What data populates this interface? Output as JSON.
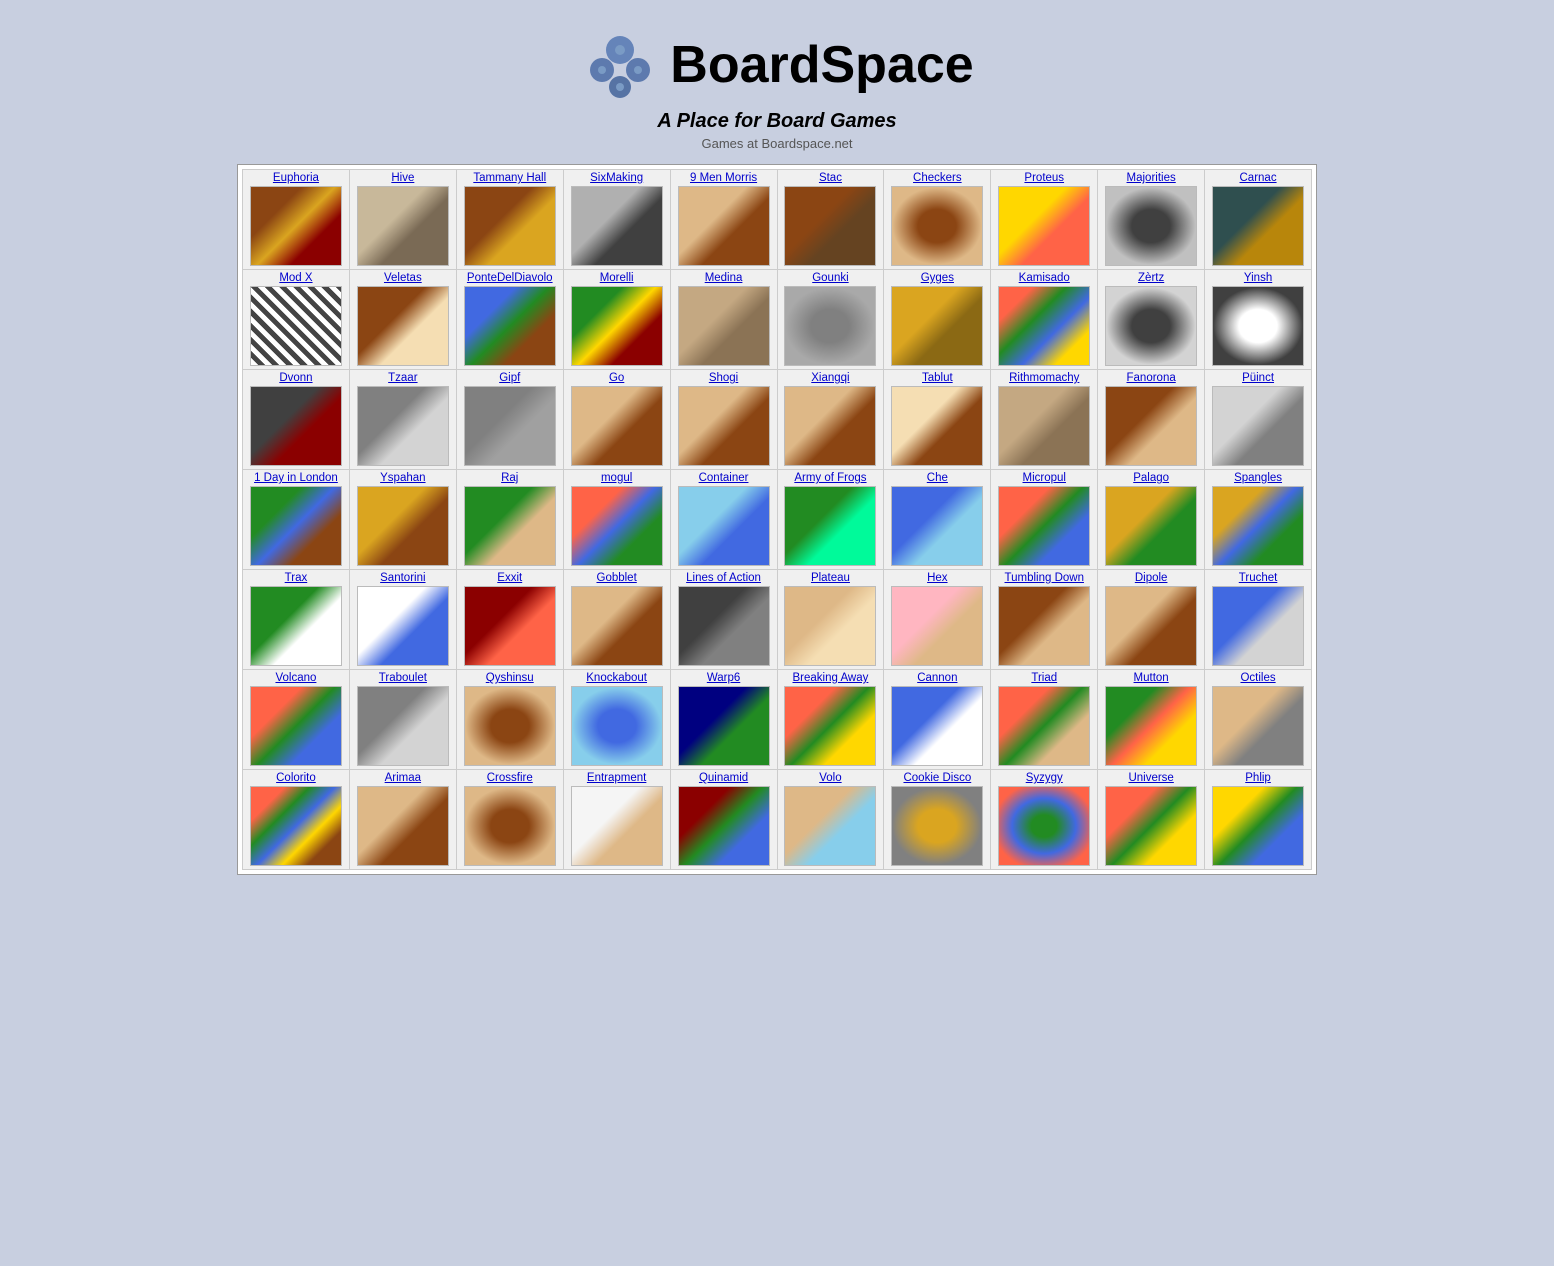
{
  "site": {
    "title": "BoardSpace",
    "tagline": "A Place for Board Games",
    "games_label": "Games at Boardspace.net"
  },
  "rows": [
    [
      {
        "name": "Euphoria",
        "thumb_class": "thumb-euphoria"
      },
      {
        "name": "Hive",
        "thumb_class": "thumb-hive"
      },
      {
        "name": "Tammany Hall",
        "thumb_class": "thumb-tammany"
      },
      {
        "name": "SixMaking",
        "thumb_class": "thumb-sixmaking"
      },
      {
        "name": "9 Men Morris",
        "thumb_class": "thumb-9men"
      },
      {
        "name": "Stac",
        "thumb_class": "thumb-stac"
      },
      {
        "name": "Checkers",
        "thumb_class": "thumb-checkers"
      },
      {
        "name": "Proteus",
        "thumb_class": "thumb-proteus"
      },
      {
        "name": "Majorities",
        "thumb_class": "thumb-majorities"
      },
      {
        "name": "Carnac",
        "thumb_class": "thumb-carnac"
      }
    ],
    [
      {
        "name": "Mod X",
        "thumb_class": "thumb-modx"
      },
      {
        "name": "Veletas",
        "thumb_class": "thumb-veletas"
      },
      {
        "name": "PonteDelDiavolo",
        "thumb_class": "thumb-ponte"
      },
      {
        "name": "Morelli",
        "thumb_class": "thumb-morelli"
      },
      {
        "name": "Medina",
        "thumb_class": "thumb-medina"
      },
      {
        "name": "Gounki",
        "thumb_class": "thumb-gounki"
      },
      {
        "name": "Gyges",
        "thumb_class": "thumb-gyges"
      },
      {
        "name": "Kamisado",
        "thumb_class": "thumb-kamisado"
      },
      {
        "name": "Zèrtz",
        "thumb_class": "thumb-zertz"
      },
      {
        "name": "Yinsh",
        "thumb_class": "thumb-yinsh"
      }
    ],
    [
      {
        "name": "Dvonn",
        "thumb_class": "thumb-dvonn"
      },
      {
        "name": "Tzaar",
        "thumb_class": "thumb-tzaar"
      },
      {
        "name": "Gipf",
        "thumb_class": "thumb-gipf"
      },
      {
        "name": "Go",
        "thumb_class": "thumb-go"
      },
      {
        "name": "Shogi",
        "thumb_class": "thumb-shogi"
      },
      {
        "name": "Xiangqi",
        "thumb_class": "thumb-xiangqi"
      },
      {
        "name": "Tablut",
        "thumb_class": "thumb-tablut"
      },
      {
        "name": "Rithmomachy",
        "thumb_class": "thumb-rithmom"
      },
      {
        "name": "Fanorona",
        "thumb_class": "thumb-fanorona"
      },
      {
        "name": "Püinct",
        "thumb_class": "thumb-punct"
      }
    ],
    [
      {
        "name": "1 Day in London",
        "thumb_class": "thumb-1day"
      },
      {
        "name": "Yspahan",
        "thumb_class": "thumb-yspahan"
      },
      {
        "name": "Raj",
        "thumb_class": "thumb-raj"
      },
      {
        "name": "mogul",
        "thumb_class": "thumb-mogul"
      },
      {
        "name": "Container",
        "thumb_class": "thumb-container"
      },
      {
        "name": "Army of Frogs",
        "thumb_class": "thumb-armyfrogs"
      },
      {
        "name": "Che",
        "thumb_class": "thumb-che"
      },
      {
        "name": "Micropul",
        "thumb_class": "thumb-micropul"
      },
      {
        "name": "Palago",
        "thumb_class": "thumb-palago"
      },
      {
        "name": "Spangles",
        "thumb_class": "thumb-spangles"
      }
    ],
    [
      {
        "name": "Trax",
        "thumb_class": "thumb-trax"
      },
      {
        "name": "Santorini",
        "thumb_class": "thumb-santorini"
      },
      {
        "name": "Exxit",
        "thumb_class": "thumb-exxit"
      },
      {
        "name": "Gobblet",
        "thumb_class": "thumb-gobblet"
      },
      {
        "name": "Lines of Action",
        "thumb_class": "thumb-loa"
      },
      {
        "name": "Plateau",
        "thumb_class": "thumb-plateau"
      },
      {
        "name": "Hex",
        "thumb_class": "thumb-hex"
      },
      {
        "name": "Tumbling Down",
        "thumb_class": "thumb-tumbling"
      },
      {
        "name": "Dipole",
        "thumb_class": "thumb-dipole"
      },
      {
        "name": "Truchet",
        "thumb_class": "thumb-truchet"
      }
    ],
    [
      {
        "name": "Volcano",
        "thumb_class": "thumb-volcano"
      },
      {
        "name": "Traboulet",
        "thumb_class": "thumb-traboulet"
      },
      {
        "name": "Qyshinsu",
        "thumb_class": "thumb-qyshinsu"
      },
      {
        "name": "Knockabout",
        "thumb_class": "thumb-knockabout"
      },
      {
        "name": "Warp6",
        "thumb_class": "thumb-warp6"
      },
      {
        "name": "Breaking Away",
        "thumb_class": "thumb-breaking"
      },
      {
        "name": "Cannon",
        "thumb_class": "thumb-cannon"
      },
      {
        "name": "Triad",
        "thumb_class": "thumb-triad"
      },
      {
        "name": "Mutton",
        "thumb_class": "thumb-mutton"
      },
      {
        "name": "Octiles",
        "thumb_class": "thumb-octiles"
      }
    ],
    [
      {
        "name": "Colorito",
        "thumb_class": "thumb-colorito"
      },
      {
        "name": "Arimaa",
        "thumb_class": "thumb-arimaa"
      },
      {
        "name": "Crossfire",
        "thumb_class": "thumb-crossfire"
      },
      {
        "name": "Entrapment",
        "thumb_class": "thumb-entrap"
      },
      {
        "name": "Quinamid",
        "thumb_class": "thumb-quinamid"
      },
      {
        "name": "Volo",
        "thumb_class": "thumb-volo"
      },
      {
        "name": "Cookie Disco",
        "thumb_class": "thumb-cookie"
      },
      {
        "name": "Syzygy",
        "thumb_class": "thumb-syzygy"
      },
      {
        "name": "Universe",
        "thumb_class": "thumb-universe"
      },
      {
        "name": "Phlip",
        "thumb_class": "thumb-phlip"
      }
    ]
  ]
}
